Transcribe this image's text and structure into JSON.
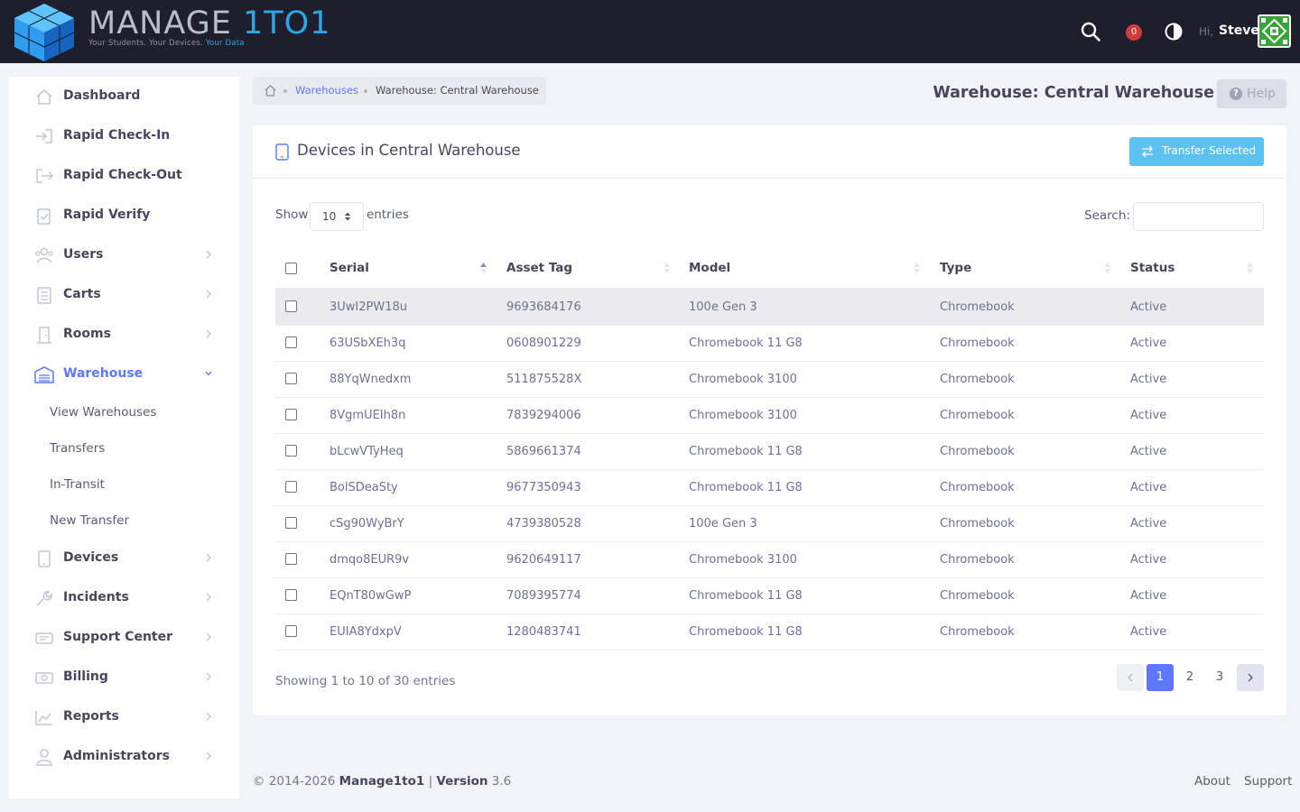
{
  "header": {
    "logo_word_main": "MANAGE ",
    "logo_word_accent": "1TO1",
    "logo_tagline_main": "Your Students. Your Devices. ",
    "logo_tagline_accent": "Your Data",
    "notification_count": "0",
    "greeting": "Hi,",
    "user_name": "Steve"
  },
  "sidebar": {
    "items": [
      {
        "label": "Dashboard",
        "icon": "home-icon"
      },
      {
        "label": "Rapid Check-In",
        "icon": "sign-in-icon"
      },
      {
        "label": "Rapid Check-Out",
        "icon": "sign-out-icon"
      },
      {
        "label": "Rapid Verify",
        "icon": "clipboard-check-icon"
      },
      {
        "label": "Users",
        "icon": "users-icon"
      },
      {
        "label": "Carts",
        "icon": "cart-icon"
      },
      {
        "label": "Rooms",
        "icon": "door-icon"
      },
      {
        "label": "Warehouse",
        "icon": "warehouse-icon"
      },
      {
        "label": "Devices",
        "icon": "tablet-icon"
      },
      {
        "label": "Incidents",
        "icon": "wrench-icon"
      },
      {
        "label": "Support Center",
        "icon": "support-icon"
      },
      {
        "label": "Billing",
        "icon": "money-icon"
      },
      {
        "label": "Reports",
        "icon": "chart-icon"
      },
      {
        "label": "Administrators",
        "icon": "admin-icon"
      }
    ],
    "sub_items": [
      {
        "label": "View Warehouses"
      },
      {
        "label": "Transfers"
      },
      {
        "label": "In-Transit"
      },
      {
        "label": "New Transfer"
      }
    ]
  },
  "breadcrumb": {
    "link": "Warehouses",
    "current": "Warehouse: Central Warehouse"
  },
  "page": {
    "title": "Warehouse: Central Warehouse",
    "help_label": "Help"
  },
  "card": {
    "title": "Devices in Central Warehouse",
    "transfer_label": "Transfer Selected",
    "show_label": "Show",
    "show_value": "10",
    "entries_label": "entries",
    "search_label": "Search:",
    "search_value": ""
  },
  "table": {
    "columns": [
      "Serial",
      "Asset Tag",
      "Model",
      "Type",
      "Status"
    ],
    "rows": [
      [
        "3UwI2PW18u",
        "9693684176",
        "100e Gen 3",
        "Chromebook",
        "Active"
      ],
      [
        "63USbXEh3q",
        "0608901229",
        "Chromebook 11 G8",
        "Chromebook",
        "Active"
      ],
      [
        "88YqWnedxm",
        "511875528X",
        "Chromebook 3100",
        "Chromebook",
        "Active"
      ],
      [
        "8VgmUEIh8n",
        "7839294006",
        "Chromebook 3100",
        "Chromebook",
        "Active"
      ],
      [
        "bLcwVTyHeq",
        "5869661374",
        "Chromebook 11 G8",
        "Chromebook",
        "Active"
      ],
      [
        "BolSDeaSty",
        "9677350943",
        "Chromebook 11 G8",
        "Chromebook",
        "Active"
      ],
      [
        "cSg90WyBrY",
        "4739380528",
        "100e Gen 3",
        "Chromebook",
        "Active"
      ],
      [
        "dmqo8EUR9v",
        "9620649117",
        "Chromebook 3100",
        "Chromebook",
        "Active"
      ],
      [
        "EQnT80wGwP",
        "7089395774",
        "Chromebook 11 G8",
        "Chromebook",
        "Active"
      ],
      [
        "EUIA8YdxpV",
        "1280483741",
        "Chromebook 11 G8",
        "Chromebook",
        "Active"
      ]
    ],
    "info": "Showing 1 to 10 of 30 entries",
    "pages": [
      "1",
      "2",
      "3"
    ],
    "current_page": "1"
  },
  "footer": {
    "copyright": "© 2014-2026 ",
    "brand": "Manage1to1",
    "separator": " | ",
    "version_label": "Version",
    "version_value": " 3.6",
    "links": [
      "About",
      "Support"
    ]
  },
  "colors": {
    "topbar": "#1e1e2d",
    "accent": "#5d78ff",
    "transfer_button": "#5cc2f2",
    "badge": "#d13b3b"
  }
}
